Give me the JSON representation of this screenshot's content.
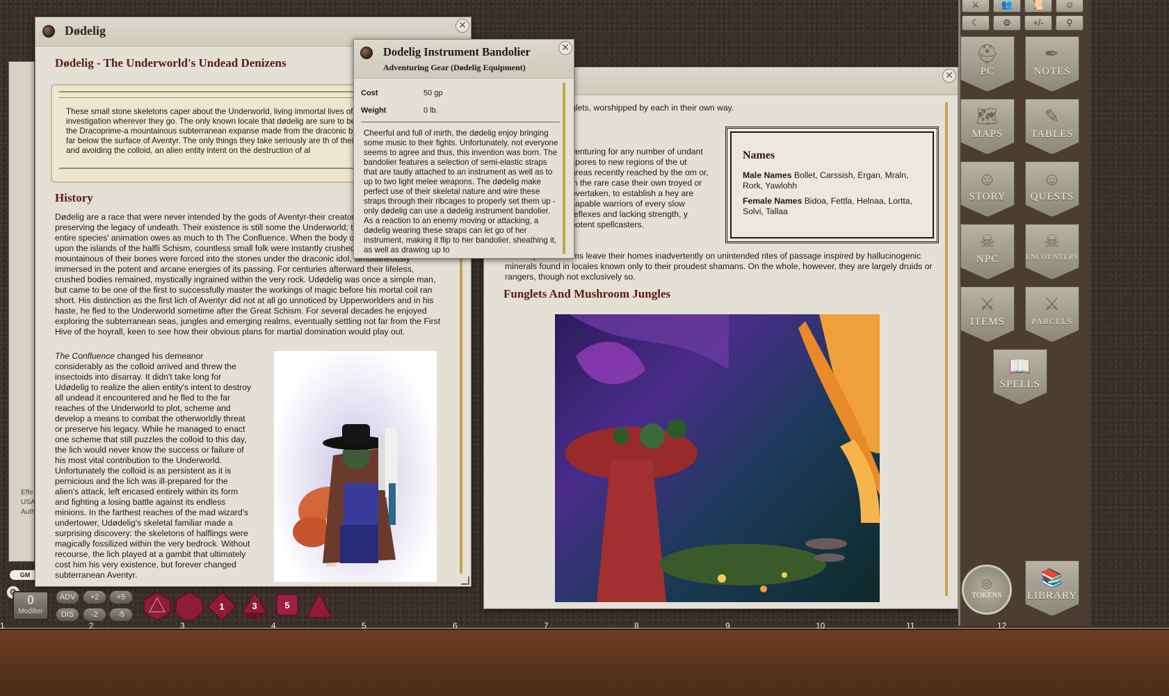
{
  "left_window": {
    "title": "Dødelig",
    "heading": "Dødelig - The Underworld's Undead Denizens",
    "boxed_text": "These small stone skeletons caper about the Underworld, living immortal lives of investigation wherever they go. The only known locale that dødelig are sure to be of the Dracoprime-a mountainous subterranean expanse made from the draconic buried far below the surface of Aventyr. The only things they take seriously are th of their kin and avoiding the colloid, an alien entity intent on the destruction of al",
    "history_heading": "History",
    "history_text": "Dødelig are a race that were never intended by the gods of Aventyr-their creator w mad wizard intent on preserving the legacy of undeath. Their existence is still some the Underworld; the truth is that their entire species' animation owes as much to th The Confluence. When the body of the Dracoprime fell upon the islands of the halfli Schism, countless small folk were instantly crushed to death under its mountainous of their bones were forced into the stones under the draconic idol, simultaneously immersed in the potent and arcane energies of its passing. For centuries afterward their lifeless, crushed bodies remained, mystically ingrained within the very rock. Udødelig was once a simple man, but came to be one of the first to successfully master the workings of magic before his mortal coil ran short. His distinction as the first lich of Aventyr did not at all go unnoticed by Upperworlders and in his haste, he fled to the Underworld sometime after the Great Schism. For several decades he enjoyed exploring the subterranean seas, jungles and emerging realms, eventually settling not far from the First Hive of the hoyrall, keen to see how their obvious plans for martial domination would play out.",
    "confluence_italic": "The Confluence",
    "confluence_text": " changed his demeanor considerably as the colloid arrived and threw the insectoids into disarray. It didn't take long for Udødelig to realize the alien entity's intent to destroy all undead it encountered and he fled to the far reaches of the Underworld to plot, scheme and develop a means to combat the otherworldly threat or preserve his legacy. While he managed to enact one scheme that still puzzles the colloid to this day, the lich would never know the success or failure of his most vital contribution to the Underworld. Unfortunately the colloid is as persistent as it is pernicious and the lich was ill-prepared for the alien's attack, left encased entirely within its form and fighting a losing battle against its endless minions. In the farthest reaches of the mad wizard's undertower, Udødelig's skeletal familiar made a surprising discovery: the skeletons of halflings were magically fossilized within the very bedrock. Without recourse, the lich played at a gambit that ultimately cost him his very existence, but forever changed subterranean Aventyr."
  },
  "popup": {
    "title": "Dodelig Instrument Bandolier",
    "subtitle": "Adventuring Gear (Dødelig Equipment)",
    "cost_label": "Cost",
    "cost_value": "50 gp",
    "weight_label": "Weight",
    "weight_value": "0 lb.",
    "description": "Cheerful and full of mirth, the dødelig enjoy bringing some music to their fights. Unfortunately, not everyone seems to agree and thus, this invention was born. The bandolier features a selection of semi-elastic straps that are tautly attached to an instrument as well as to up to two light melee weapons. The dødelig make perfect use of their skeletal nature and wire these straps through their ribcages to properly set them up - only dødelig can use a dødelig instrument bandolier. As a reaction to an enemy moving or attacking, a dødelig wearing these straps can let go of her instrument, making it flip to her bandolier, sheathing it, as well as drawing up to"
  },
  "right_window": {
    "top_fragment": "glets, worshipped by each in their own way.",
    "left_col_text": "venturing for any number of undant spores to new regions of the ut areas recently reached by the om or, in the rare case their own troyed or overtaken, to establish a hey are capable warriors of every slow reflexes and lacking strength, y potent spellcasters.",
    "para2": "s or holy mushrooms leave their homes inadvertently on unintended rites of passage inspired by hallucinogenic minerals found in locales known only to their proudest shamans. On the whole, however, they are largely druids or rangers, though not exclusively so.",
    "section_heading": "Funglets And Mushroom Jungles",
    "names_box": {
      "title": "Names",
      "male_label": "Male Names",
      "male_values": " Bollet, Carssish, Ergan, Mraln, Rork, Yawlohh",
      "female_label": "Female Names",
      "female_values": " Bidoa, Fettla, Helnaa, Lortta, Solvi, Tallaa"
    }
  },
  "sidebar": {
    "top_icons": [
      "⚔",
      "👥",
      "📜",
      "☺",
      "☾",
      "⚙",
      "+/-",
      "⚲"
    ],
    "buttons": [
      {
        "label": "PC",
        "icon": "helmet-icon"
      },
      {
        "label": "NOTES",
        "icon": "quill-icon"
      },
      {
        "label": "MAPS",
        "icon": "map-icon"
      },
      {
        "label": "TABLES",
        "icon": "table-quill-icon"
      },
      {
        "label": "STORY",
        "icon": "masks-icon"
      },
      {
        "label": "QUESTS",
        "icon": "masks-icon"
      },
      {
        "label": "NPC",
        "icon": "demon-icon"
      },
      {
        "label": "ENCOUNTERS",
        "icon": "demon-icon"
      },
      {
        "label": "ITEMS",
        "icon": "armor-sword-icon"
      },
      {
        "label": "PARCELS",
        "icon": "armor-sword-icon"
      },
      {
        "label": "SPELLS",
        "icon": "spellbook-icon"
      },
      {
        "label": "TOKENS",
        "icon": "token-icon"
      },
      {
        "label": "LIBRARY",
        "icon": "book-icon"
      }
    ]
  },
  "bottom_bar": {
    "modifier_value": "0",
    "modifier_label": "Modifier",
    "mod_buttons": [
      "ADV",
      "+2",
      "+5",
      "DIS",
      "-2",
      "-5"
    ],
    "dice": [
      "d20",
      "d12",
      "d10",
      "d8",
      "d6",
      "d4"
    ],
    "dice_labels": [
      "",
      "",
      "1",
      "3",
      "5",
      ""
    ],
    "gm_label": "GM",
    "ruler": [
      "1",
      "2",
      "3",
      "4",
      "5",
      "6",
      "7",
      "8",
      "9",
      "10",
      "11",
      "12"
    ]
  },
  "left_frame_fragments": {
    "line1": "Effe",
    "line2": "USA",
    "line3": "Auth"
  },
  "colors": {
    "heading": "#5a1a14",
    "parchment": "#efe6cf",
    "dice_red": "#8e1b3a",
    "scroll_gold": "#c9a24c"
  }
}
